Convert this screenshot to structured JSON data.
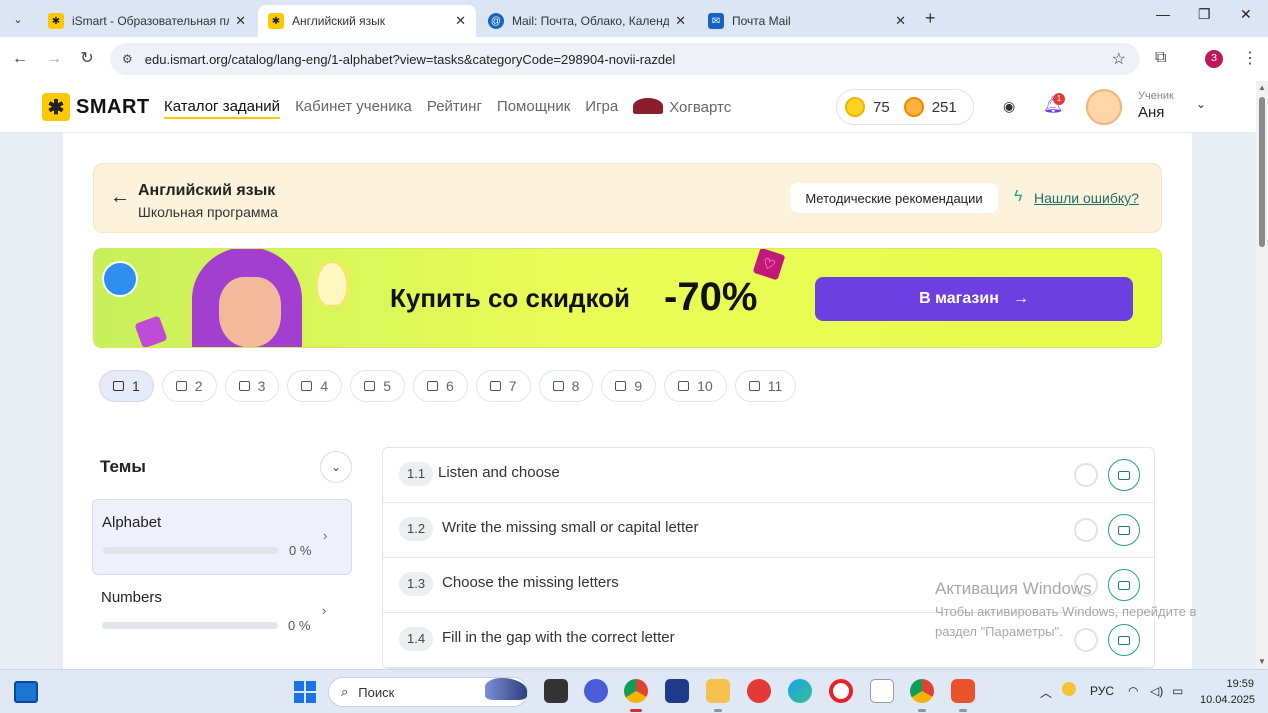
{
  "browser": {
    "tabs": [
      {
        "title": "iSmart - Образовательная пла",
        "active": false
      },
      {
        "title": "Английский язык",
        "active": true
      },
      {
        "title": "Mail: Почта, Облако, Календар",
        "active": false
      },
      {
        "title": "Почта Mail",
        "active": false
      }
    ],
    "url": "edu.ismart.org/catalog/lang-eng/1-alphabet?view=tasks&categoryCode=298904-novii-razdel",
    "profile_letter": "З"
  },
  "header": {
    "logo_text": "SMART",
    "nav": [
      "Каталог заданий",
      "Кабинет ученика",
      "Рейтинг",
      "Помощник",
      "Игра",
      "Хогвартс"
    ],
    "coins": "75",
    "smiles": "251",
    "notifications": "1",
    "user_role": "Ученик",
    "user_name": "Аня"
  },
  "subject": {
    "title": "Английский язык",
    "subtitle": "Школьная программа",
    "methods_button": "Методические рекомендации",
    "error_link": "Нашли ошибку?"
  },
  "banner": {
    "text": "Купить со скидкой",
    "discount": "-70%",
    "button": "В магазин"
  },
  "grades": [
    {
      "label": "1",
      "active": true
    },
    {
      "label": "2",
      "active": false
    },
    {
      "label": "3",
      "active": false
    },
    {
      "label": "4",
      "active": false
    },
    {
      "label": "5",
      "active": false
    },
    {
      "label": "6",
      "active": false
    },
    {
      "label": "7",
      "active": false
    },
    {
      "label": "8",
      "active": false
    },
    {
      "label": "9",
      "active": false
    },
    {
      "label": "10",
      "active": false
    },
    {
      "label": "11",
      "active": false
    }
  ],
  "topics": {
    "title": "Темы",
    "items": [
      {
        "name": "Alphabet",
        "progress": "0 %",
        "active": true
      },
      {
        "name": "Numbers",
        "progress": "0 %",
        "active": false
      }
    ]
  },
  "tasks": [
    {
      "num": "1.1",
      "text": "Listen and choose"
    },
    {
      "num": "1.2",
      "text": "Write the missing small or capital letter"
    },
    {
      "num": "1.3",
      "text": "Choose the missing letters"
    },
    {
      "num": "1.4",
      "text": "Fill in the gap with the correct letter"
    }
  ],
  "watermark": {
    "title": "Активация Windows",
    "text": "Чтобы активировать Windows, перейдите в раздел \"Параметры\"."
  },
  "taskbar": {
    "search": "Поиск",
    "lang": "РУС",
    "time": "19:59",
    "date": "10.04.2025"
  },
  "colors": {
    "brand_yellow": "#ffc800",
    "accent_purple": "#6e3fe0",
    "banner_green": "#e6fb4a",
    "teal": "#26a08a"
  }
}
